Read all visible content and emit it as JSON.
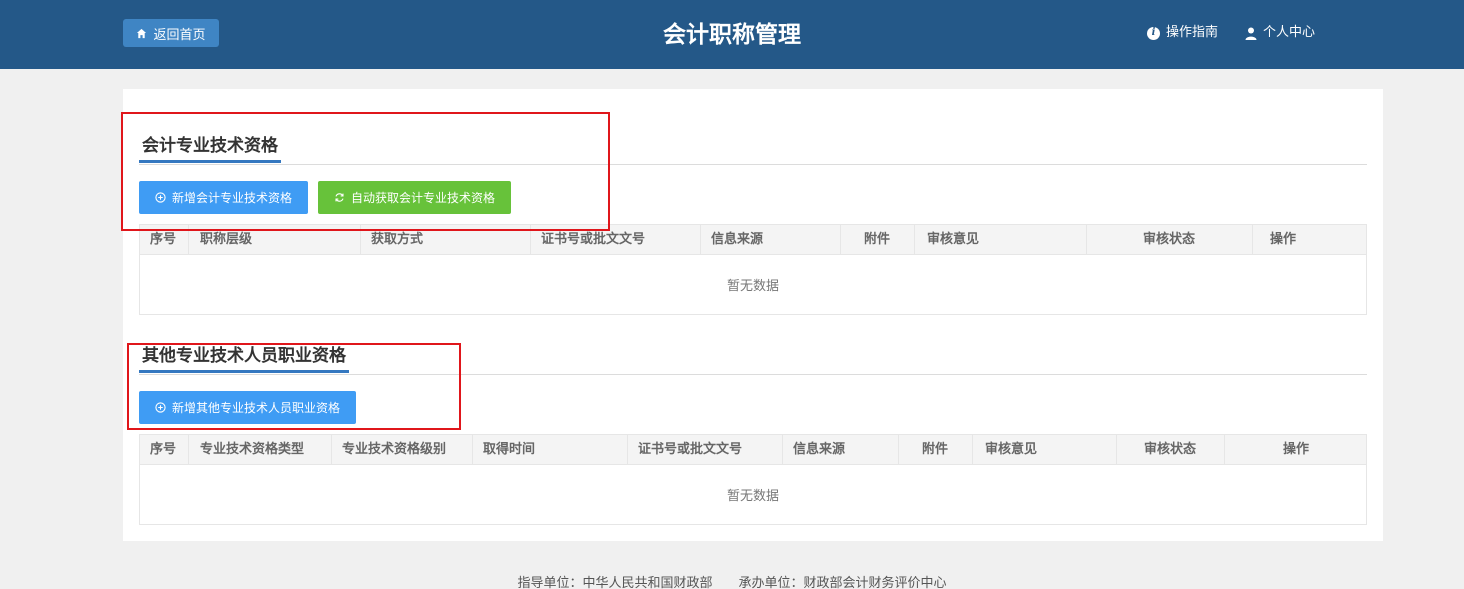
{
  "header": {
    "home_label": "返回首页",
    "title": "会计职称管理",
    "guide_label": "操作指南",
    "user_label": "个人中心"
  },
  "section1": {
    "title": "会计专业技术资格",
    "add_button": "新增会计专业技术资格",
    "auto_button": "自动获取会计专业技术资格",
    "columns": [
      "序号",
      "职称层级",
      "获取方式",
      "证书号或批文文号",
      "信息来源",
      "附件",
      "审核意见",
      "审核状态",
      "操作"
    ],
    "empty_text": "暂无数据"
  },
  "section2": {
    "title": "其他专业技术人员职业资格",
    "add_button": "新增其他专业技术人员职业资格",
    "columns": [
      "序号",
      "专业技术资格类型",
      "专业技术资格级别",
      "取得时间",
      "证书号或批文文号",
      "信息来源",
      "附件",
      "审核意见",
      "审核状态",
      "操作"
    ],
    "empty_text": "暂无数据"
  },
  "footer": {
    "guide_unit": "指导单位：中华人民共和国财政部",
    "host_unit": "承办单位：财政部会计财务评价中心"
  },
  "colors": {
    "header_bg": "#245888",
    "primary": "#3f9cf4",
    "success": "#67c23a",
    "highlight": "#e0161b"
  }
}
